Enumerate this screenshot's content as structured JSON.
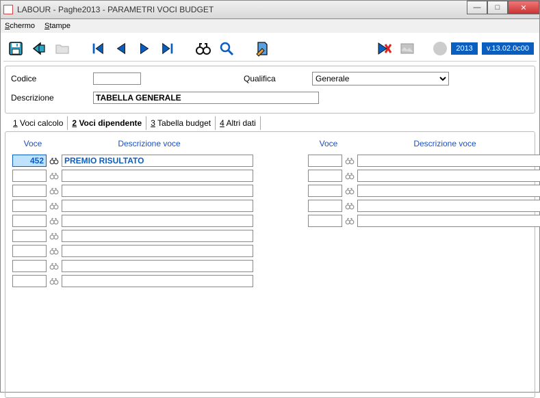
{
  "window": {
    "title": "LABOUR - Paghe2013 - PARAMETRI VOCI BUDGET"
  },
  "menu": {
    "schermo": "Schermo",
    "stampe": "Stampe"
  },
  "status": {
    "year": "2013",
    "version": "v.13.02.0c00"
  },
  "form": {
    "codice_label": "Codice",
    "codice_value": "",
    "qualifica_label": "Qualifica",
    "qualifica_value": "Generale",
    "descrizione_label": "Descrizione",
    "descrizione_value": "TABELLA GENERALE"
  },
  "tabs": {
    "t1": "Voci calcolo",
    "t2": "Voci dipendente",
    "t3": "Tabella budget",
    "t4": "Altri dati"
  },
  "grid": {
    "hdr_voce": "Voce",
    "hdr_desc": "Descrizione voce",
    "left": [
      {
        "voce": "452",
        "desc": "PREMIO RISULTATO"
      },
      {
        "voce": "",
        "desc": ""
      },
      {
        "voce": "",
        "desc": ""
      },
      {
        "voce": "",
        "desc": ""
      },
      {
        "voce": "",
        "desc": ""
      },
      {
        "voce": "",
        "desc": ""
      },
      {
        "voce": "",
        "desc": ""
      },
      {
        "voce": "",
        "desc": ""
      },
      {
        "voce": "",
        "desc": ""
      }
    ],
    "right": [
      {
        "voce": "",
        "desc": ""
      },
      {
        "voce": "",
        "desc": ""
      },
      {
        "voce": "",
        "desc": ""
      },
      {
        "voce": "",
        "desc": ""
      },
      {
        "voce": "",
        "desc": ""
      }
    ]
  }
}
